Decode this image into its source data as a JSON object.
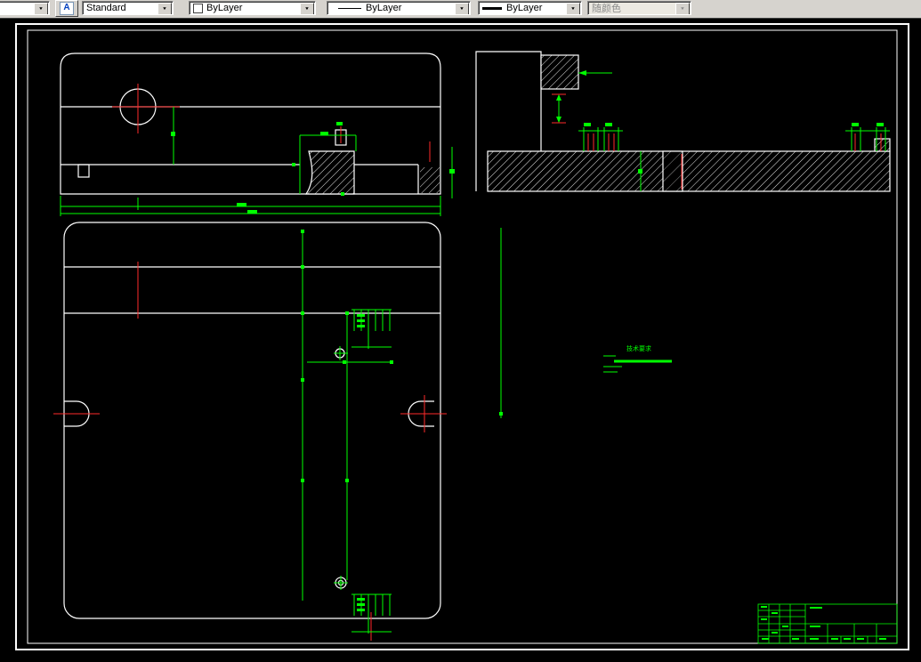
{
  "app": {
    "name": "CAD drawing editor"
  },
  "toolbar": {
    "dropdown_glyph": "▼",
    "style_button_glyph": "A",
    "style_combo": {
      "value": "Standard"
    },
    "color_combo": {
      "value": "ByLayer",
      "swatch_color": "#ffffff"
    },
    "linetype_combo": {
      "value": "ByLayer"
    },
    "lineweight_combo": {
      "value": "ByLayer"
    },
    "plotstyle_combo": {
      "value": "随颜色",
      "disabled": true
    }
  },
  "colors": {
    "canvas_bg": "#000000",
    "toolbar_bg": "#d6d3ce",
    "drawing_outline": "#ffffff",
    "dimension_green": "#00ff00",
    "centerline_red": "#ff2a2a"
  },
  "annotation": {
    "tech_note_title": "技术要求"
  }
}
